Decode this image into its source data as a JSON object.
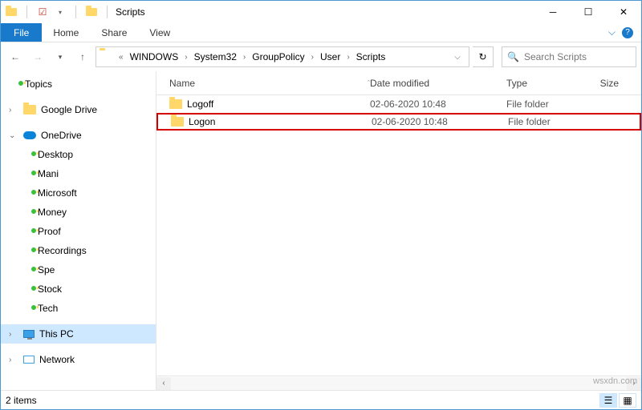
{
  "window": {
    "title": "Scripts"
  },
  "qat": {
    "icons": [
      "folder",
      "checkmark",
      "folder"
    ]
  },
  "ribbon": {
    "file": "File",
    "tabs": [
      "Home",
      "Share",
      "View"
    ]
  },
  "breadcrumbs": [
    "WINDOWS",
    "System32",
    "GroupPolicy",
    "User",
    "Scripts"
  ],
  "search": {
    "placeholder": "Search Scripts"
  },
  "nav": {
    "topics": "Topics",
    "googleDrive": "Google Drive",
    "onedrive": "OneDrive",
    "onedriveChildren": [
      "Desktop",
      "Mani",
      "Microsoft",
      "Money",
      "Proof",
      "Recordings",
      "Spe",
      "Stock",
      "Tech"
    ],
    "thisPC": "This PC",
    "network": "Network"
  },
  "columns": {
    "name": "Name",
    "date": "Date modified",
    "type": "Type",
    "size": "Size"
  },
  "files": [
    {
      "name": "Logoff",
      "date": "02-06-2020 10:48",
      "type": "File folder",
      "highlight": false
    },
    {
      "name": "Logon",
      "date": "02-06-2020 10:48",
      "type": "File folder",
      "highlight": true
    }
  ],
  "status": {
    "count": "2 items"
  },
  "watermark": "wsxdn.com"
}
